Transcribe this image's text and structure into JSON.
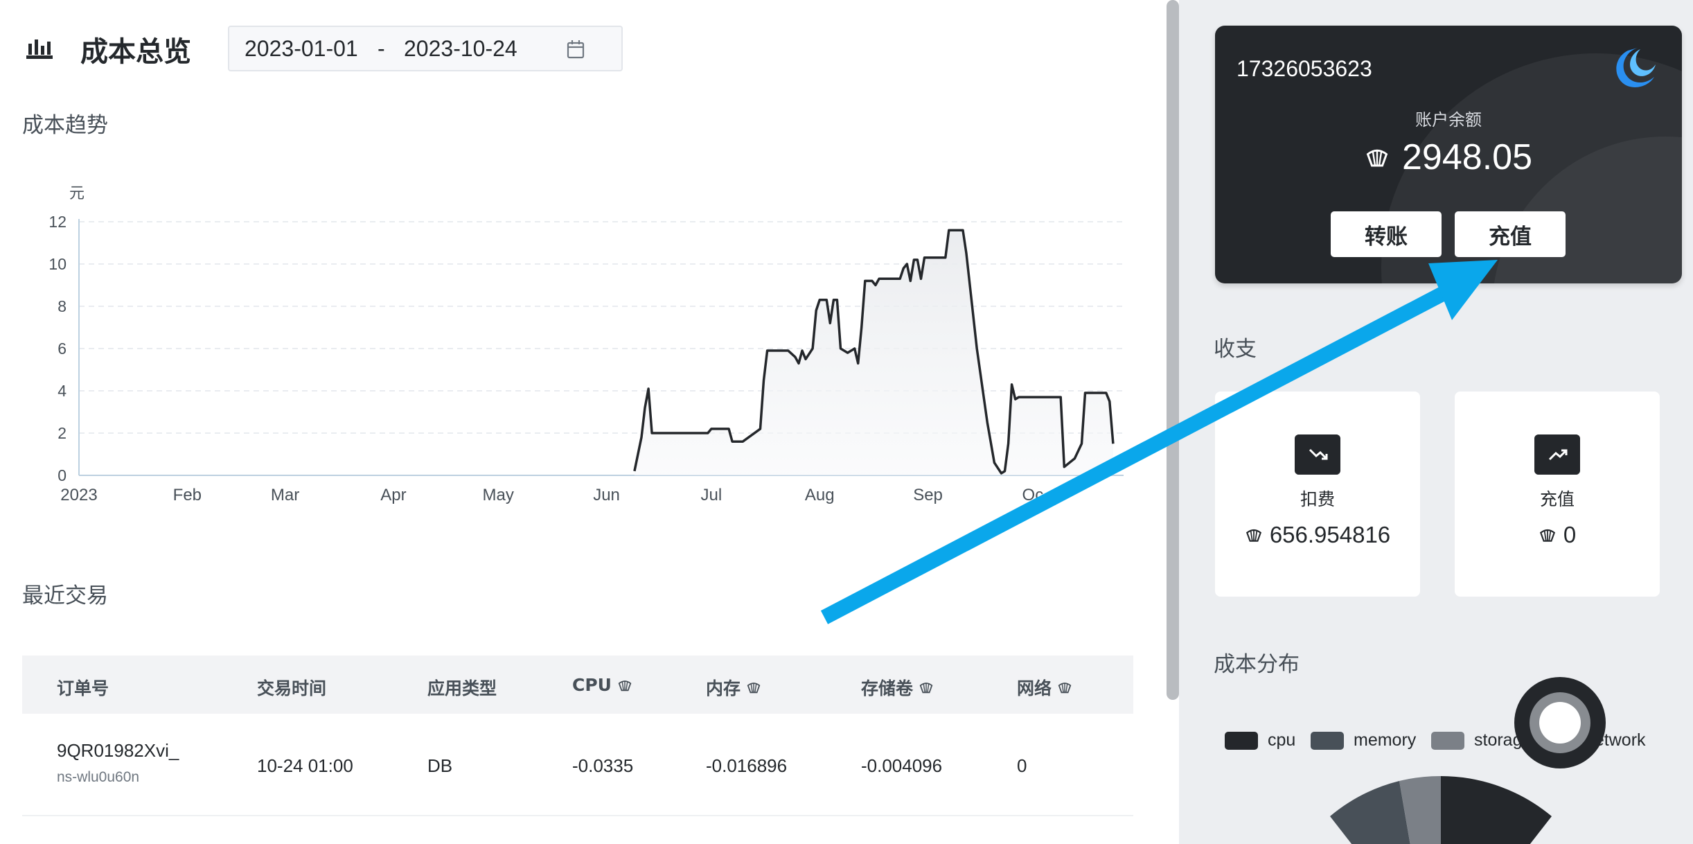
{
  "header": {
    "title": "成本总览",
    "date_start": "2023-01-01",
    "date_sep": "-",
    "date_end": "2023-10-24"
  },
  "sections": {
    "trend": "成本趋势",
    "recent": "最近交易",
    "income": "收支",
    "distribution": "成本分布"
  },
  "icons": {
    "header": "bar-chart-icon",
    "date": "calendar-icon",
    "currency": "shell-coin-icon",
    "debit": "trending-down-icon",
    "credit": "trending-up-icon",
    "brand": "brand-logo-icon"
  },
  "chart_data": {
    "type": "area",
    "ylabel": "元",
    "ylim": [
      0,
      12
    ],
    "y_ticks": [
      "0",
      "2",
      "4",
      "6",
      "8",
      "10",
      "12"
    ],
    "x_ticks": [
      "2023",
      "Feb",
      "Mar",
      "Apr",
      "May",
      "Jun",
      "Jul",
      "Aug",
      "Sep",
      "Oc"
    ],
    "grid": true,
    "series": [
      {
        "points": [
          [
            "2023-06-09",
            0.2
          ],
          [
            "2023-06-11",
            1.8
          ],
          [
            "2023-06-12",
            3.2
          ],
          [
            "2023-06-13",
            4.1
          ],
          [
            "2023-06-14",
            2.0
          ],
          [
            "2023-06-30",
            2.0
          ],
          [
            "2023-07-01",
            2.2
          ],
          [
            "2023-07-06",
            2.2
          ],
          [
            "2023-07-07",
            1.6
          ],
          [
            "2023-07-10",
            1.6
          ],
          [
            "2023-07-15",
            2.2
          ],
          [
            "2023-07-16",
            4.5
          ],
          [
            "2023-07-17",
            5.9
          ],
          [
            "2023-07-23",
            5.9
          ],
          [
            "2023-07-25",
            5.6
          ],
          [
            "2023-07-26",
            5.3
          ],
          [
            "2023-07-27",
            5.9
          ],
          [
            "2023-07-28",
            5.5
          ],
          [
            "2023-07-30",
            6.0
          ],
          [
            "2023-07-31",
            7.8
          ],
          [
            "2023-08-01",
            8.3
          ],
          [
            "2023-08-03",
            8.3
          ],
          [
            "2023-08-04",
            7.2
          ],
          [
            "2023-08-05",
            8.3
          ],
          [
            "2023-08-06",
            8.3
          ],
          [
            "2023-08-07",
            6.0
          ],
          [
            "2023-08-09",
            5.8
          ],
          [
            "2023-08-11",
            6.0
          ],
          [
            "2023-08-12",
            5.3
          ],
          [
            "2023-08-13",
            7.0
          ],
          [
            "2023-08-14",
            9.2
          ],
          [
            "2023-08-16",
            9.2
          ],
          [
            "2023-08-17",
            9.0
          ],
          [
            "2023-08-18",
            9.3
          ],
          [
            "2023-08-24",
            9.3
          ],
          [
            "2023-08-25",
            9.8
          ],
          [
            "2023-08-26",
            10.0
          ],
          [
            "2023-08-27",
            9.2
          ],
          [
            "2023-08-28",
            10.2
          ],
          [
            "2023-08-29",
            10.2
          ],
          [
            "2023-08-30",
            9.3
          ],
          [
            "2023-08-31",
            10.3
          ],
          [
            "2023-09-06",
            10.3
          ],
          [
            "2023-09-07",
            11.6
          ],
          [
            "2023-09-11",
            11.6
          ],
          [
            "2023-09-12",
            10.5
          ],
          [
            "2023-09-15",
            6.0
          ],
          [
            "2023-09-18",
            2.5
          ],
          [
            "2023-09-20",
            0.6
          ],
          [
            "2023-09-22",
            0.1
          ],
          [
            "2023-09-23",
            0.2
          ],
          [
            "2023-09-24",
            1.5
          ],
          [
            "2023-09-25",
            4.3
          ],
          [
            "2023-09-26",
            3.6
          ],
          [
            "2023-09-27",
            3.7
          ],
          [
            "2023-10-09",
            3.7
          ],
          [
            "2023-10-10",
            0.4
          ],
          [
            "2023-10-13",
            0.8
          ],
          [
            "2023-10-15",
            1.5
          ],
          [
            "2023-10-16",
            3.9
          ],
          [
            "2023-10-22",
            3.9
          ],
          [
            "2023-10-23",
            3.5
          ],
          [
            "2023-10-24",
            1.5
          ]
        ]
      }
    ]
  },
  "table": {
    "headers": [
      "订单号",
      "交易时间",
      "应用类型",
      "CPU",
      "内存",
      "存储卷",
      "网络"
    ],
    "header_has_coin": [
      false,
      false,
      false,
      true,
      true,
      true,
      true
    ],
    "rows": [
      {
        "order_id": "9QR01982Xvi_",
        "namespace": "ns-wlu0u60n",
        "time": "10-24 01:00",
        "app_type": "DB",
        "cpu": "-0.0335",
        "memory": "-0.016896",
        "storage": "-0.004096",
        "network": "0"
      }
    ]
  },
  "balance_card": {
    "phone": "17326053623",
    "label": "账户余额",
    "amount": "2948.05",
    "transfer_label": "转账",
    "recharge_label": "充值"
  },
  "stats": {
    "debit": {
      "label": "扣费",
      "value": "656.954816"
    },
    "credit": {
      "label": "充值",
      "value": "0"
    }
  },
  "distribution": {
    "legend": [
      {
        "name": "cpu",
        "color": "#24272b"
      },
      {
        "name": "memory",
        "color": "#485058"
      },
      {
        "name": "storage",
        "color": "#7b8087"
      },
      {
        "name": "network",
        "color": "#b5b8bd"
      }
    ]
  },
  "colors": {
    "accent_arrow": "#0aa7eb",
    "dark": "#24272b",
    "panel_bg": "#eceef1"
  }
}
